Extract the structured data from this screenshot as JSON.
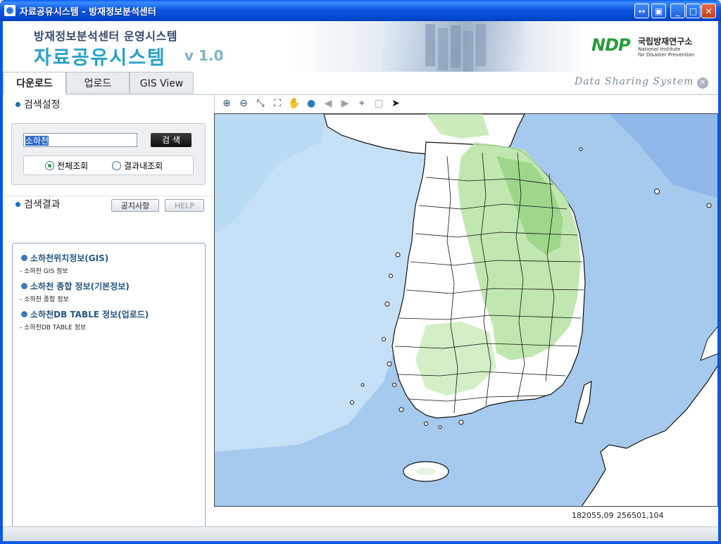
{
  "window": {
    "title": "자료공유시스템 - 방재정보분석센터",
    "buttons": [
      "restore-alt",
      "window-alt",
      "minimize",
      "maximize",
      "close"
    ]
  },
  "banner": {
    "subtitle": "방재정보분석센터 운영시스템",
    "title": "자료공유시스템",
    "version": "v 1.0",
    "logo_text": "NDP",
    "org_korean": "국립방재연구소",
    "org_english_1": "National Institute",
    "org_english_2": "for Disaster Prevention"
  },
  "tabs": [
    {
      "label": "다운로드",
      "active": true
    },
    {
      "label": "업로드",
      "active": false
    },
    {
      "label": "GIS View",
      "active": false
    }
  ],
  "brand_tagline": "Data Sharing System",
  "search": {
    "section_title": "검색설정",
    "query": "소하천",
    "button_label": "검 색",
    "options": [
      {
        "label": "전체조회",
        "selected": true
      },
      {
        "label": "결과내조회",
        "selected": false
      }
    ]
  },
  "results": {
    "section_title": "검색결과",
    "notice_label": "공지사항",
    "help_label": "HELP",
    "items": [
      {
        "title": "소하천위치정보(GIS)",
        "subtitle": "- 소하천 GIS 정보"
      },
      {
        "title": "소하천 종합 정보(기본정보)",
        "subtitle": "- 소하천 종합 정보"
      },
      {
        "title": "소하천DB TABLE 정보(업로드)",
        "subtitle": "- 소하천DB TABLE 정보"
      }
    ]
  },
  "map": {
    "tools": [
      "zoom-in-icon",
      "zoom-out-icon",
      "zoom-extent-icon",
      "full-extent-icon",
      "pan-hand-icon",
      "globe-icon",
      "back-arrow-icon",
      "forward-arrow-icon",
      "identify-icon",
      "clear-icon",
      "pointer-icon"
    ],
    "coord_x": "182055,09",
    "coord_y": "256501,104"
  },
  "colors": {
    "sea": "#a6c9ee",
    "shallow_sea": "#c5e1f7",
    "land": "#ffffff",
    "vegetation": "#9ed88a",
    "brand_blue": "#2ba0c7",
    "brand_green": "#2a9b3c"
  }
}
